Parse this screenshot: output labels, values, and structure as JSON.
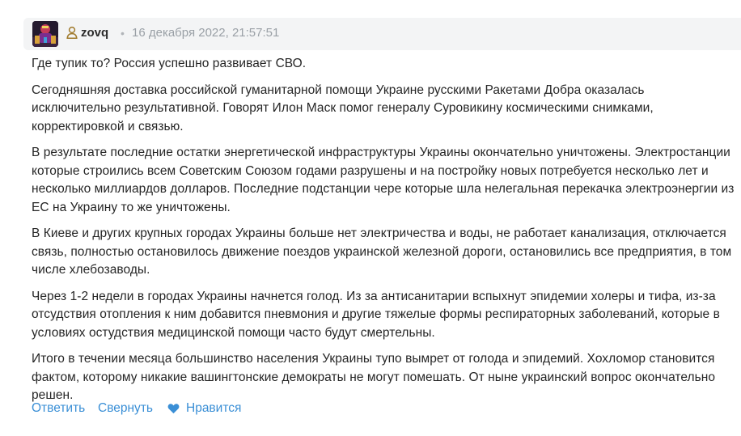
{
  "comment": {
    "author": "zovq",
    "separator": "•",
    "timestamp": "16 декабря 2022, 21:57:51",
    "paragraphs": [
      "Где тупик то? Россия успешно развивает СВО.",
      "Сегодняшняя доставка российской гуманитарной помощи Украине русскими Ракетами Добра оказалась исключительно результативной. Говорят Илон Маск помог генералу Суровикину космическими снимками, корректировкой и связью.",
      "В результате последние остатки энергетической инфраструктуры Украины окончательно уничтожены. Электростанции которые строились всем Советским Союзом годами разрушены и на постройку новых потребуется несколько лет и несколько миллиардов долларов. Последние подстанции чере которые шла нелегальная перекачка электроэнергии из ЕС на Украину то же уничтожены.",
      "В Киеве и других крупных городах Украины больше нет электричества и воды, не работает канализация, отключается связь, полностью остановилось движение поездов украинской железной дороги, остановились все предприятия, в том числе хлебозаводы.",
      "Через 1-2 недели в городах Украины начнется голод. Из за антисанитарии вспыхнут эпидемии холеры и тифа, из-за отсудствия отопления к ним добавится пневмония и другие тяжелые формы респираторных заболеваний, которые в условиях остудствия медицинской помощи часто будут смертельны.",
      "Итого в течении месяца большинство населения Украины тупо вымрет от голода и эпидемий. Хохломор становится фактом, которому никакие вашингтонские демократы не могут помешать. От ныне украинский вопрос окончательно решен."
    ]
  },
  "actions": {
    "reply": "Ответить",
    "collapse": "Свернуть",
    "like": "Нравится"
  },
  "icons": {
    "user": "user-icon",
    "like": "heart-icon"
  },
  "colors": {
    "link": "#3a8fd6",
    "header_bg": "#f3f4f5",
    "muted": "#9aa0a6"
  }
}
